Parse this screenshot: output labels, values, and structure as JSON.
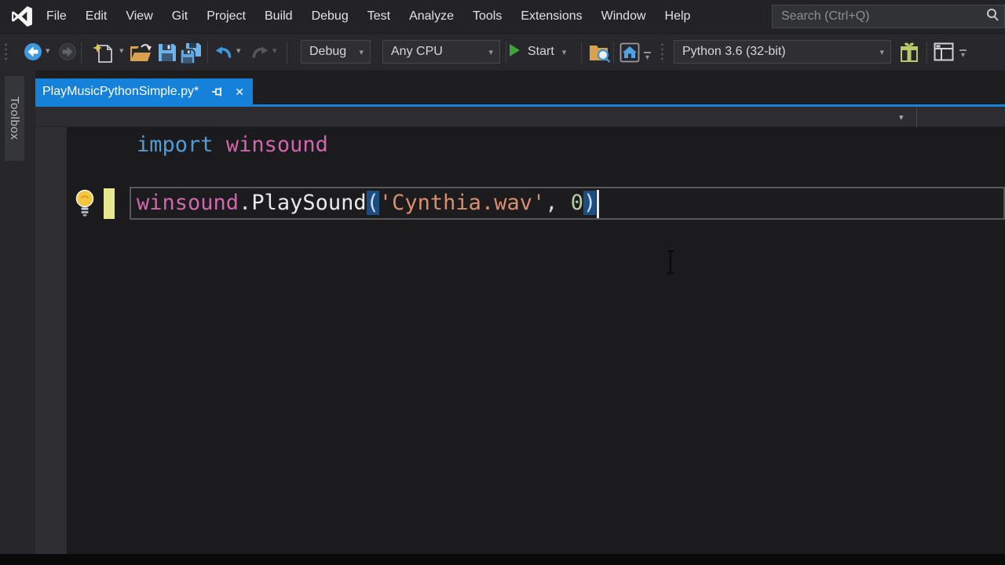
{
  "menubar": {
    "items": [
      "File",
      "Edit",
      "View",
      "Git",
      "Project",
      "Build",
      "Debug",
      "Test",
      "Analyze",
      "Tools",
      "Extensions",
      "Window",
      "Help"
    ],
    "search_placeholder": "Search (Ctrl+Q)"
  },
  "toolbar": {
    "solution_config": "Debug",
    "solution_platform": "Any CPU",
    "start_label": "Start",
    "python_environment": "Python 3.6 (32-bit)"
  },
  "document_tab": {
    "title": "PlayMusicPythonSimple.py*"
  },
  "toolbox_label": "Toolbox",
  "editor": {
    "line1": {
      "keyword": "import",
      "space": " ",
      "module": "winsound"
    },
    "line3": {
      "module": "winsound",
      "dot": ".",
      "func": "PlaySound",
      "open_paren": "(",
      "string": "'Cynthia.wav'",
      "comma": ", ",
      "number": "0",
      "close_paren": ")"
    }
  },
  "glyphs": {
    "caret_down": "▾",
    "close": "✕"
  },
  "colors": {
    "accent_blue": "#1581d8",
    "keyword_blue": "#509cd6",
    "module_pink": "#d066ac",
    "string_orange": "#db8e6f",
    "number_green": "#b3cea2",
    "brace_match_bg": "#1d4e7f",
    "modified_bar_yellow": "#e8e891",
    "start_green": "#3fa43f",
    "lightbulb_yellow": "#f2c73b"
  }
}
